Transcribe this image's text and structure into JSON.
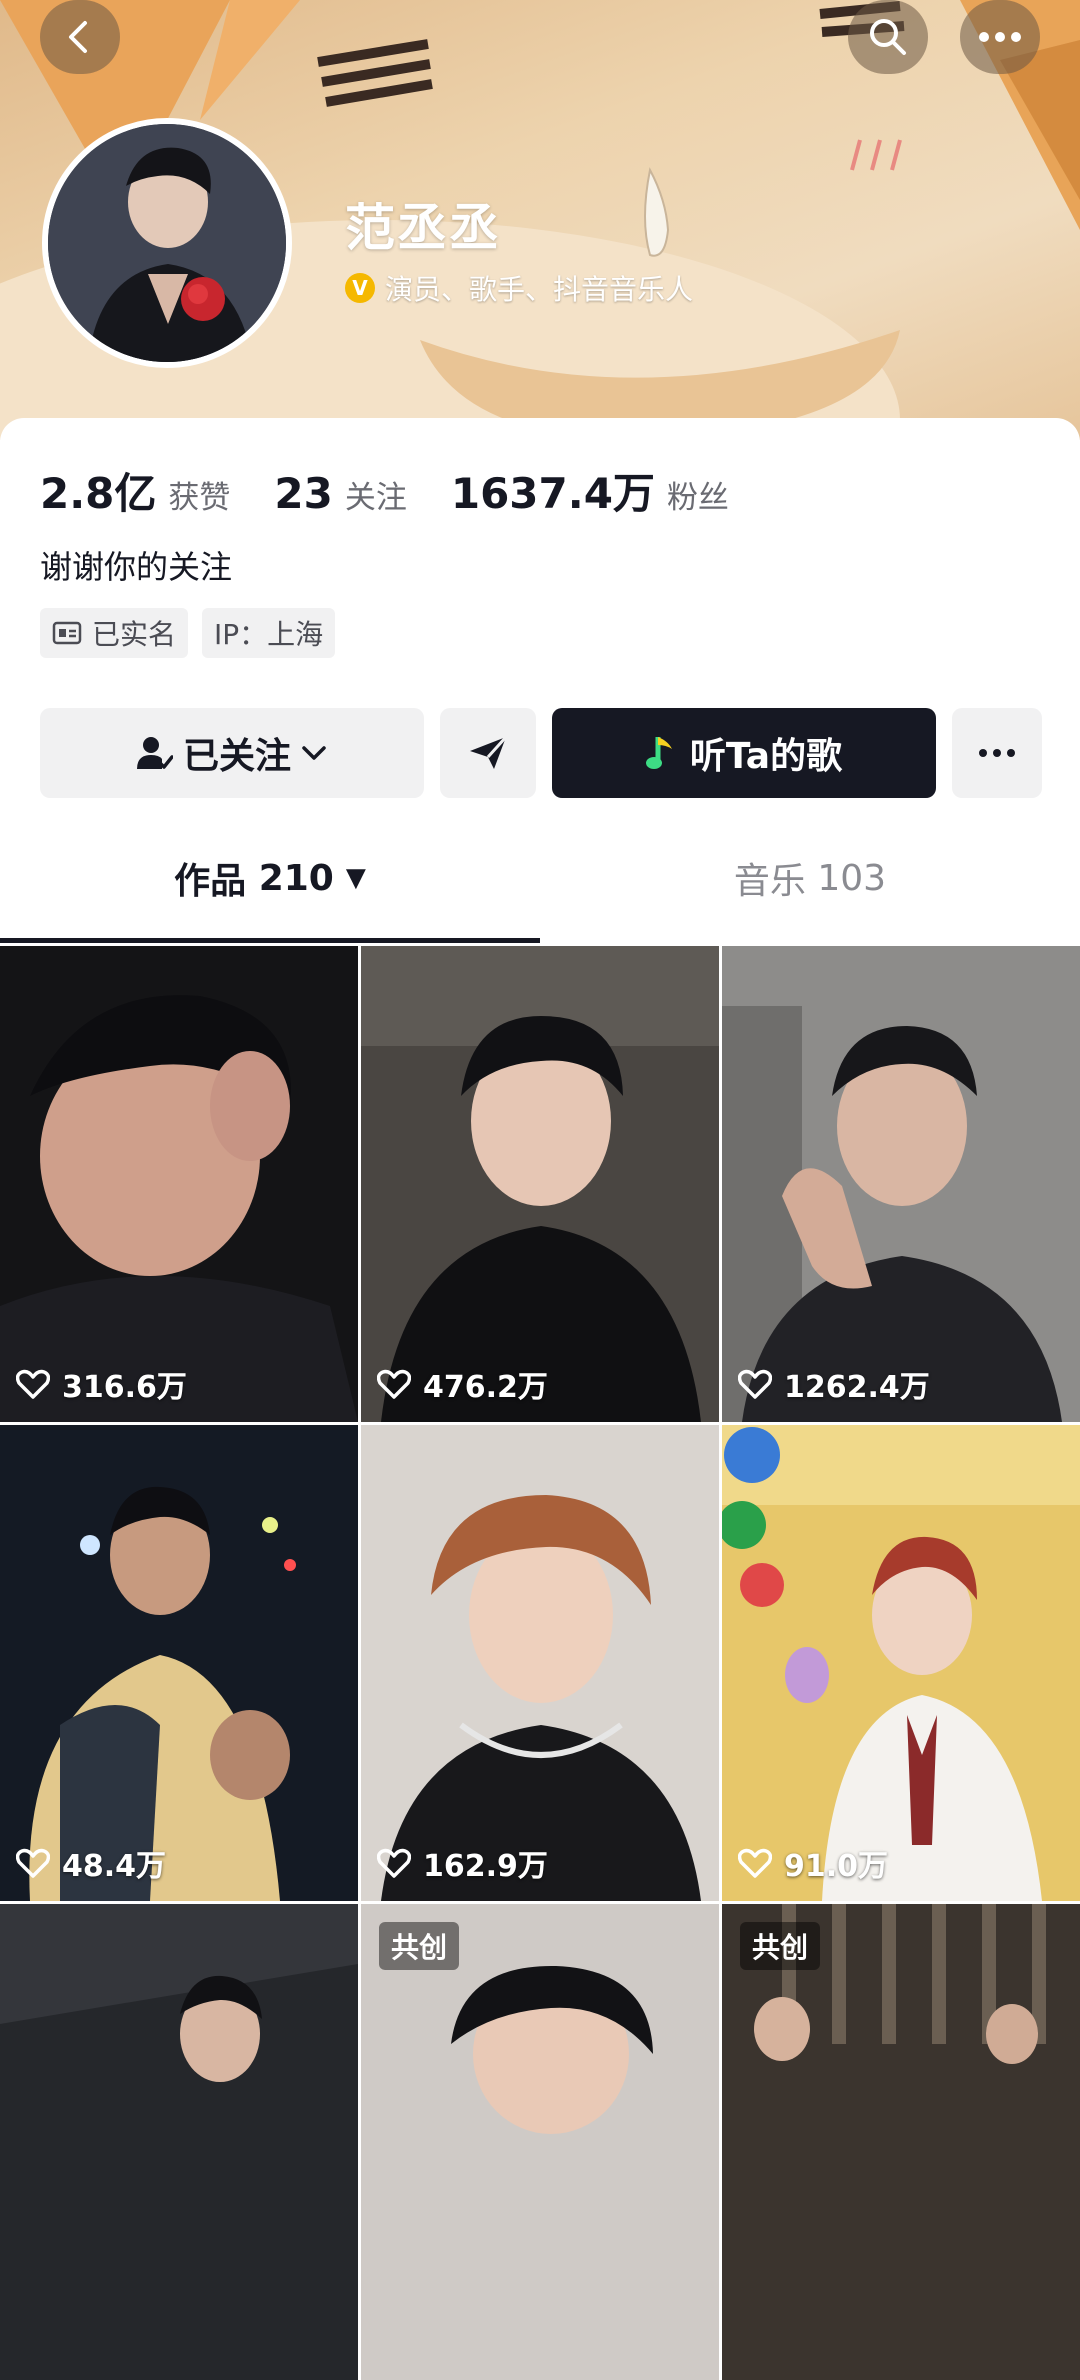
{
  "header": {
    "back_icon": "chevron-left-icon",
    "search_icon": "search-icon",
    "more_icon": "ellipsis-icon"
  },
  "profile": {
    "name": "范丞丞",
    "verified_badge": "V",
    "verified_text": "演员、歌手、抖音音乐人",
    "bio": "谢谢你的关注"
  },
  "stats": {
    "likes_value": "2.8亿",
    "likes_label": "获赞",
    "following_value": "23",
    "following_label": "关注",
    "followers_value": "1637.4万",
    "followers_label": "粉丝"
  },
  "tags": {
    "realname": "已实名",
    "ip": "IP：上海"
  },
  "actions": {
    "follow_label": "已关注",
    "music_label": "听Ta的歌"
  },
  "tabs": {
    "works_label": "作品",
    "works_count": "210",
    "music_label": "音乐",
    "music_count": "103"
  },
  "videos": [
    {
      "likes": "316.6万"
    },
    {
      "likes": "476.2万"
    },
    {
      "likes": "1262.4万"
    },
    {
      "likes": "48.4万"
    },
    {
      "likes": "162.9万"
    },
    {
      "likes": "91.0万"
    },
    {
      "likes": ""
    },
    {
      "likes": "",
      "badge": "共创"
    },
    {
      "likes": "",
      "badge": "共创"
    }
  ],
  "colors": {
    "primary_text": "#161823",
    "secondary_text": "#6a6b72",
    "button_gray": "#f1f1f2",
    "verify_gold": "#f5b800",
    "music_green": "#3ddc84"
  }
}
